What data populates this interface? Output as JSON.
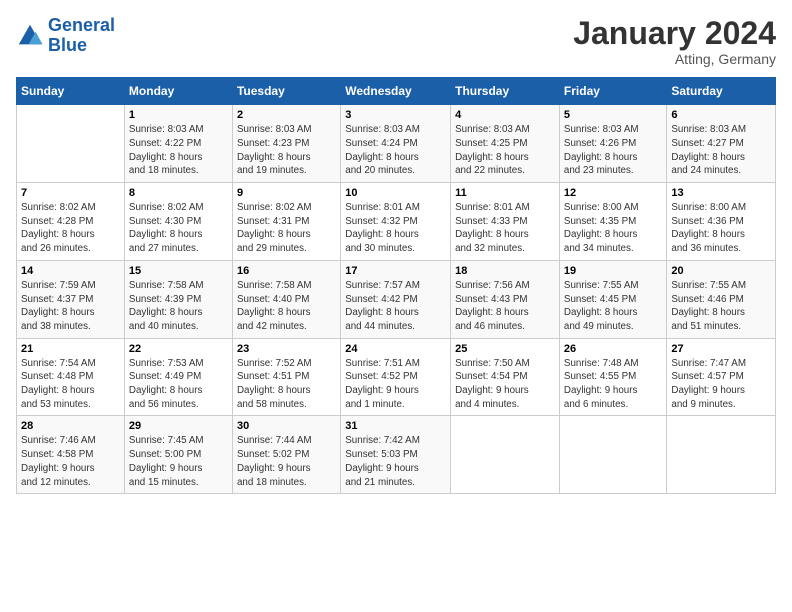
{
  "header": {
    "logo_general": "General",
    "logo_blue": "Blue",
    "title": "January 2024",
    "subtitle": "Atting, Germany"
  },
  "days_of_week": [
    "Sunday",
    "Monday",
    "Tuesday",
    "Wednesday",
    "Thursday",
    "Friday",
    "Saturday"
  ],
  "weeks": [
    [
      {
        "day": "",
        "info": ""
      },
      {
        "day": "1",
        "info": "Sunrise: 8:03 AM\nSunset: 4:22 PM\nDaylight: 8 hours\nand 18 minutes."
      },
      {
        "day": "2",
        "info": "Sunrise: 8:03 AM\nSunset: 4:23 PM\nDaylight: 8 hours\nand 19 minutes."
      },
      {
        "day": "3",
        "info": "Sunrise: 8:03 AM\nSunset: 4:24 PM\nDaylight: 8 hours\nand 20 minutes."
      },
      {
        "day": "4",
        "info": "Sunrise: 8:03 AM\nSunset: 4:25 PM\nDaylight: 8 hours\nand 22 minutes."
      },
      {
        "day": "5",
        "info": "Sunrise: 8:03 AM\nSunset: 4:26 PM\nDaylight: 8 hours\nand 23 minutes."
      },
      {
        "day": "6",
        "info": "Sunrise: 8:03 AM\nSunset: 4:27 PM\nDaylight: 8 hours\nand 24 minutes."
      }
    ],
    [
      {
        "day": "7",
        "info": "Sunrise: 8:02 AM\nSunset: 4:28 PM\nDaylight: 8 hours\nand 26 minutes."
      },
      {
        "day": "8",
        "info": "Sunrise: 8:02 AM\nSunset: 4:30 PM\nDaylight: 8 hours\nand 27 minutes."
      },
      {
        "day": "9",
        "info": "Sunrise: 8:02 AM\nSunset: 4:31 PM\nDaylight: 8 hours\nand 29 minutes."
      },
      {
        "day": "10",
        "info": "Sunrise: 8:01 AM\nSunset: 4:32 PM\nDaylight: 8 hours\nand 30 minutes."
      },
      {
        "day": "11",
        "info": "Sunrise: 8:01 AM\nSunset: 4:33 PM\nDaylight: 8 hours\nand 32 minutes."
      },
      {
        "day": "12",
        "info": "Sunrise: 8:00 AM\nSunset: 4:35 PM\nDaylight: 8 hours\nand 34 minutes."
      },
      {
        "day": "13",
        "info": "Sunrise: 8:00 AM\nSunset: 4:36 PM\nDaylight: 8 hours\nand 36 minutes."
      }
    ],
    [
      {
        "day": "14",
        "info": "Sunrise: 7:59 AM\nSunset: 4:37 PM\nDaylight: 8 hours\nand 38 minutes."
      },
      {
        "day": "15",
        "info": "Sunrise: 7:58 AM\nSunset: 4:39 PM\nDaylight: 8 hours\nand 40 minutes."
      },
      {
        "day": "16",
        "info": "Sunrise: 7:58 AM\nSunset: 4:40 PM\nDaylight: 8 hours\nand 42 minutes."
      },
      {
        "day": "17",
        "info": "Sunrise: 7:57 AM\nSunset: 4:42 PM\nDaylight: 8 hours\nand 44 minutes."
      },
      {
        "day": "18",
        "info": "Sunrise: 7:56 AM\nSunset: 4:43 PM\nDaylight: 8 hours\nand 46 minutes."
      },
      {
        "day": "19",
        "info": "Sunrise: 7:55 AM\nSunset: 4:45 PM\nDaylight: 8 hours\nand 49 minutes."
      },
      {
        "day": "20",
        "info": "Sunrise: 7:55 AM\nSunset: 4:46 PM\nDaylight: 8 hours\nand 51 minutes."
      }
    ],
    [
      {
        "day": "21",
        "info": "Sunrise: 7:54 AM\nSunset: 4:48 PM\nDaylight: 8 hours\nand 53 minutes."
      },
      {
        "day": "22",
        "info": "Sunrise: 7:53 AM\nSunset: 4:49 PM\nDaylight: 8 hours\nand 56 minutes."
      },
      {
        "day": "23",
        "info": "Sunrise: 7:52 AM\nSunset: 4:51 PM\nDaylight: 8 hours\nand 58 minutes."
      },
      {
        "day": "24",
        "info": "Sunrise: 7:51 AM\nSunset: 4:52 PM\nDaylight: 9 hours\nand 1 minute."
      },
      {
        "day": "25",
        "info": "Sunrise: 7:50 AM\nSunset: 4:54 PM\nDaylight: 9 hours\nand 4 minutes."
      },
      {
        "day": "26",
        "info": "Sunrise: 7:48 AM\nSunset: 4:55 PM\nDaylight: 9 hours\nand 6 minutes."
      },
      {
        "day": "27",
        "info": "Sunrise: 7:47 AM\nSunset: 4:57 PM\nDaylight: 9 hours\nand 9 minutes."
      }
    ],
    [
      {
        "day": "28",
        "info": "Sunrise: 7:46 AM\nSunset: 4:58 PM\nDaylight: 9 hours\nand 12 minutes."
      },
      {
        "day": "29",
        "info": "Sunrise: 7:45 AM\nSunset: 5:00 PM\nDaylight: 9 hours\nand 15 minutes."
      },
      {
        "day": "30",
        "info": "Sunrise: 7:44 AM\nSunset: 5:02 PM\nDaylight: 9 hours\nand 18 minutes."
      },
      {
        "day": "31",
        "info": "Sunrise: 7:42 AM\nSunset: 5:03 PM\nDaylight: 9 hours\nand 21 minutes."
      },
      {
        "day": "",
        "info": ""
      },
      {
        "day": "",
        "info": ""
      },
      {
        "day": "",
        "info": ""
      }
    ]
  ]
}
